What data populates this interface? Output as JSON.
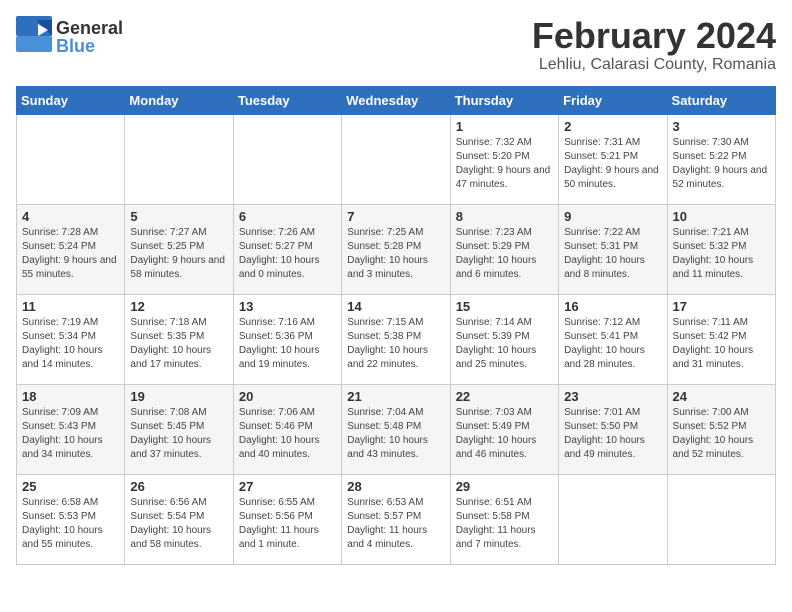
{
  "logo": {
    "general": "General",
    "blue": "Blue"
  },
  "header": {
    "month": "February 2024",
    "location": "Lehliu, Calarasi County, Romania"
  },
  "weekdays": [
    "Sunday",
    "Monday",
    "Tuesday",
    "Wednesday",
    "Thursday",
    "Friday",
    "Saturday"
  ],
  "weeks": [
    [
      {
        "day": "",
        "info": ""
      },
      {
        "day": "",
        "info": ""
      },
      {
        "day": "",
        "info": ""
      },
      {
        "day": "",
        "info": ""
      },
      {
        "day": "1",
        "info": "Sunrise: 7:32 AM\nSunset: 5:20 PM\nDaylight: 9 hours and 47 minutes."
      },
      {
        "day": "2",
        "info": "Sunrise: 7:31 AM\nSunset: 5:21 PM\nDaylight: 9 hours and 50 minutes."
      },
      {
        "day": "3",
        "info": "Sunrise: 7:30 AM\nSunset: 5:22 PM\nDaylight: 9 hours and 52 minutes."
      }
    ],
    [
      {
        "day": "4",
        "info": "Sunrise: 7:28 AM\nSunset: 5:24 PM\nDaylight: 9 hours and 55 minutes."
      },
      {
        "day": "5",
        "info": "Sunrise: 7:27 AM\nSunset: 5:25 PM\nDaylight: 9 hours and 58 minutes."
      },
      {
        "day": "6",
        "info": "Sunrise: 7:26 AM\nSunset: 5:27 PM\nDaylight: 10 hours and 0 minutes."
      },
      {
        "day": "7",
        "info": "Sunrise: 7:25 AM\nSunset: 5:28 PM\nDaylight: 10 hours and 3 minutes."
      },
      {
        "day": "8",
        "info": "Sunrise: 7:23 AM\nSunset: 5:29 PM\nDaylight: 10 hours and 6 minutes."
      },
      {
        "day": "9",
        "info": "Sunrise: 7:22 AM\nSunset: 5:31 PM\nDaylight: 10 hours and 8 minutes."
      },
      {
        "day": "10",
        "info": "Sunrise: 7:21 AM\nSunset: 5:32 PM\nDaylight: 10 hours and 11 minutes."
      }
    ],
    [
      {
        "day": "11",
        "info": "Sunrise: 7:19 AM\nSunset: 5:34 PM\nDaylight: 10 hours and 14 minutes."
      },
      {
        "day": "12",
        "info": "Sunrise: 7:18 AM\nSunset: 5:35 PM\nDaylight: 10 hours and 17 minutes."
      },
      {
        "day": "13",
        "info": "Sunrise: 7:16 AM\nSunset: 5:36 PM\nDaylight: 10 hours and 19 minutes."
      },
      {
        "day": "14",
        "info": "Sunrise: 7:15 AM\nSunset: 5:38 PM\nDaylight: 10 hours and 22 minutes."
      },
      {
        "day": "15",
        "info": "Sunrise: 7:14 AM\nSunset: 5:39 PM\nDaylight: 10 hours and 25 minutes."
      },
      {
        "day": "16",
        "info": "Sunrise: 7:12 AM\nSunset: 5:41 PM\nDaylight: 10 hours and 28 minutes."
      },
      {
        "day": "17",
        "info": "Sunrise: 7:11 AM\nSunset: 5:42 PM\nDaylight: 10 hours and 31 minutes."
      }
    ],
    [
      {
        "day": "18",
        "info": "Sunrise: 7:09 AM\nSunset: 5:43 PM\nDaylight: 10 hours and 34 minutes."
      },
      {
        "day": "19",
        "info": "Sunrise: 7:08 AM\nSunset: 5:45 PM\nDaylight: 10 hours and 37 minutes."
      },
      {
        "day": "20",
        "info": "Sunrise: 7:06 AM\nSunset: 5:46 PM\nDaylight: 10 hours and 40 minutes."
      },
      {
        "day": "21",
        "info": "Sunrise: 7:04 AM\nSunset: 5:48 PM\nDaylight: 10 hours and 43 minutes."
      },
      {
        "day": "22",
        "info": "Sunrise: 7:03 AM\nSunset: 5:49 PM\nDaylight: 10 hours and 46 minutes."
      },
      {
        "day": "23",
        "info": "Sunrise: 7:01 AM\nSunset: 5:50 PM\nDaylight: 10 hours and 49 minutes."
      },
      {
        "day": "24",
        "info": "Sunrise: 7:00 AM\nSunset: 5:52 PM\nDaylight: 10 hours and 52 minutes."
      }
    ],
    [
      {
        "day": "25",
        "info": "Sunrise: 6:58 AM\nSunset: 5:53 PM\nDaylight: 10 hours and 55 minutes."
      },
      {
        "day": "26",
        "info": "Sunrise: 6:56 AM\nSunset: 5:54 PM\nDaylight: 10 hours and 58 minutes."
      },
      {
        "day": "27",
        "info": "Sunrise: 6:55 AM\nSunset: 5:56 PM\nDaylight: 11 hours and 1 minute."
      },
      {
        "day": "28",
        "info": "Sunrise: 6:53 AM\nSunset: 5:57 PM\nDaylight: 11 hours and 4 minutes."
      },
      {
        "day": "29",
        "info": "Sunrise: 6:51 AM\nSunset: 5:58 PM\nDaylight: 11 hours and 7 minutes."
      },
      {
        "day": "",
        "info": ""
      },
      {
        "day": "",
        "info": ""
      }
    ]
  ]
}
